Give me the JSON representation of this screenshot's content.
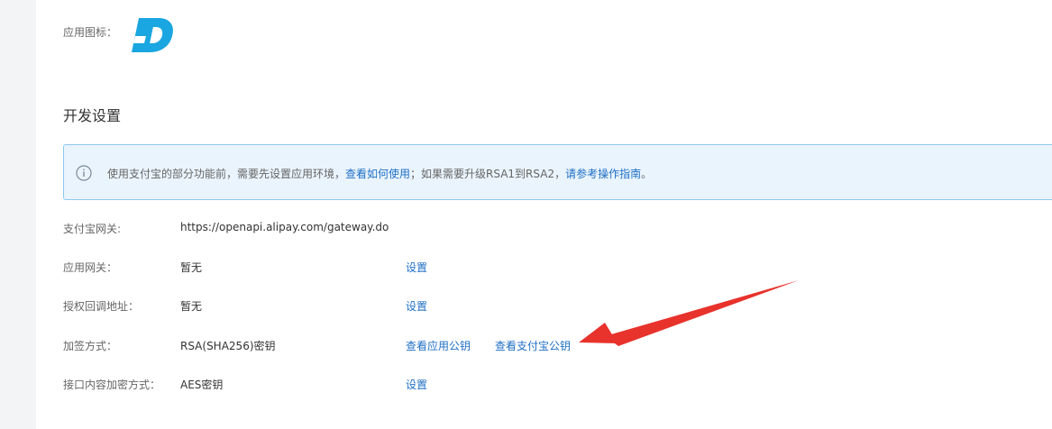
{
  "app_icon": {
    "label": "应用图标："
  },
  "dev_settings": {
    "title": "开发设置",
    "notice": {
      "text_before": "使用支付宝的部分功能前，需要先设置应用环境，",
      "link_how_to_use": "查看如何使用",
      "text_middle": "；如果需要升级RSA1到RSA2，",
      "link_guide": "请参考操作指南",
      "text_end": "。"
    },
    "rows": [
      {
        "label": "支付宝网关:",
        "value": "https://openapi.alipay.com/gateway.do"
      },
      {
        "label": "应用网关：",
        "value": "暂无",
        "link": "设置"
      },
      {
        "label": "授权回调地址：",
        "value": "暂无",
        "link": "设置"
      },
      {
        "label": "加签方式：",
        "value": "RSA(SHA256)密钥",
        "link": "查看应用公钥",
        "link2": "查看支付宝公钥"
      },
      {
        "label": "接口内容加密方式：",
        "value": "AES密钥",
        "link": "设置"
      }
    ]
  },
  "colors": {
    "link": "#1f6fc5",
    "alert_bg": "#eaf4fc",
    "alert_border": "#8cc8ee",
    "logo": "#1aa6e0",
    "annotation_arrow": "#e8322c"
  }
}
